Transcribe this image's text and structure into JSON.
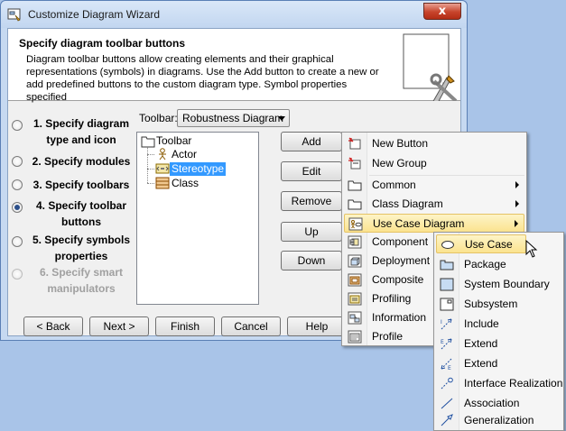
{
  "window": {
    "title": "Customize Diagram Wizard",
    "close_label": "x"
  },
  "header": {
    "title": "Specify diagram toolbar buttons",
    "description": "Diagram toolbar buttons allow creating elements and their graphical representations (symbols) in diagrams. Use the Add button to create a new or add predefined buttons to the custom diagram type. Symbol properties specified"
  },
  "steps": [
    {
      "label": "1. Specify diagram type and icon",
      "state": "normal"
    },
    {
      "label": "2. Specify modules",
      "state": "normal"
    },
    {
      "label": "3. Specify toolbars",
      "state": "normal"
    },
    {
      "label": "4. Specify toolbar buttons",
      "state": "checked"
    },
    {
      "label": "5. Specify symbols properties",
      "state": "normal"
    },
    {
      "label": "6. Specify smart manipulators",
      "state": "disabled"
    }
  ],
  "toolbar": {
    "label": "Toolbar:",
    "selected": "Robustness Diagram"
  },
  "tree": {
    "root": "Toolbar",
    "children": [
      "Actor",
      "Stereotype",
      "Class"
    ],
    "selected_index": 1
  },
  "side_buttons": {
    "add": "Add",
    "edit": "Edit",
    "remove": "Remove",
    "up": "Up",
    "down": "Down"
  },
  "footer_buttons": {
    "back": "< Back",
    "next": "Next >",
    "finish": "Finish",
    "cancel": "Cancel",
    "help": "Help"
  },
  "menu": {
    "items": [
      "New Button",
      "New Group",
      "Common",
      "Class Diagram",
      "Use Case Diagram",
      "Component",
      "Deployment",
      "Composite",
      "Profiling",
      "Information",
      "Profile"
    ],
    "highlighted": "Use Case Diagram"
  },
  "submenu": {
    "items": [
      "Use Case",
      "Package",
      "System Boundary",
      "Subsystem",
      "Include",
      "Extend",
      "Extend",
      "Interface Realization",
      "Association",
      "Generalization"
    ],
    "highlighted": "Use Case"
  },
  "colors": {
    "desktop": "#a9c4e8",
    "selection": "#3399ff",
    "menu_highlight": "#fbe38f"
  }
}
